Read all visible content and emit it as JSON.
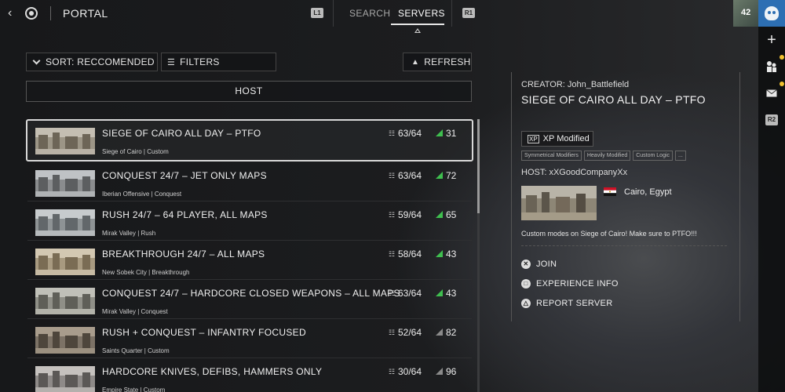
{
  "header": {
    "title": "PORTAL",
    "l1_label": "L1",
    "r1_label": "R1",
    "tabs": [
      {
        "label": "SEARCH",
        "active": false
      },
      {
        "label": "SERVERS",
        "active": true
      }
    ]
  },
  "profile": {
    "level": "42"
  },
  "rail": {
    "icons": [
      "skull-icon",
      "plus-icon",
      "party-icon",
      "mail-icon"
    ],
    "r2_label": "R2",
    "notification_color": "#f2c230"
  },
  "toolbar": {
    "sort_label": "SORT: RECCOMENDED",
    "filters_label": "FILTERS",
    "refresh_label": "REFRESH"
  },
  "list_header": {
    "host_label": "HOST"
  },
  "servers": [
    {
      "name": "SIEGE OF CAIRO ALL DAY – PTFO",
      "sub": "Siege of Cairo | Custom",
      "players": "63/64",
      "ping": "31",
      "ping_good": true,
      "selected": true
    },
    {
      "name": "CONQUEST 24/7 – JET ONLY MAPS",
      "sub": "Iberian Offensive | Conquest",
      "players": "63/64",
      "ping": "72",
      "ping_good": true,
      "selected": false
    },
    {
      "name": "RUSH 24/7 – 64  PLAYER, ALL MAPS",
      "sub": "Mirak Valley | Rush",
      "players": "59/64",
      "ping": "65",
      "ping_good": true,
      "selected": false
    },
    {
      "name": "BREAKTHROUGH 24/7 – ALL MAPS",
      "sub": "New Sobek City | Breakthrough",
      "players": "58/64",
      "ping": "43",
      "ping_good": true,
      "selected": false
    },
    {
      "name": "CONQUEST 24/7 – HARDCORE CLOSED WEAPONS – ALL MAPS",
      "sub": "Mirak Valley | Conquest",
      "players": "63/64",
      "ping": "43",
      "ping_good": true,
      "selected": false
    },
    {
      "name": "RUSH + CONQUEST – INFANTRY FOCUSED",
      "sub": "Saints Quarter | Custom",
      "players": "52/64",
      "ping": "82",
      "ping_good": false,
      "selected": false
    },
    {
      "name": "HARDCORE KNIVES, DEFIBS, HAMMERS ONLY",
      "sub": "Empire State | Custom",
      "players": "30/64",
      "ping": "96",
      "ping_good": false,
      "selected": false
    }
  ],
  "colors": {
    "ping_good": "#3fbf4f",
    "ping_bad": "#8a8a8a",
    "selection_border": "#d8d8d8"
  },
  "detail": {
    "creator": "CREATOR:  John_Battlefield",
    "title": "SIEGE OF CAIRO ALL DAY – PTFO",
    "xp_label": "XP Modified",
    "xp_icon_text": "XP",
    "tags": [
      "Symmetrical Modifiers",
      "Heavily Modified",
      "Custom Logic",
      "..."
    ],
    "host": "HOST:  xXGoodCompanyXx",
    "location": "Cairo, Egypt",
    "description": "Custom modes on Siege of Cairo! Make sure to PTFO!!!",
    "actions": [
      {
        "label": "JOIN",
        "icon": "x-button-icon",
        "glyph": "✕"
      },
      {
        "label": "EXPERIENCE INFO",
        "icon": "square-button-icon",
        "glyph": "□"
      },
      {
        "label": "REPORT SERVER",
        "icon": "triangle-button-icon",
        "glyph": "△"
      }
    ]
  }
}
